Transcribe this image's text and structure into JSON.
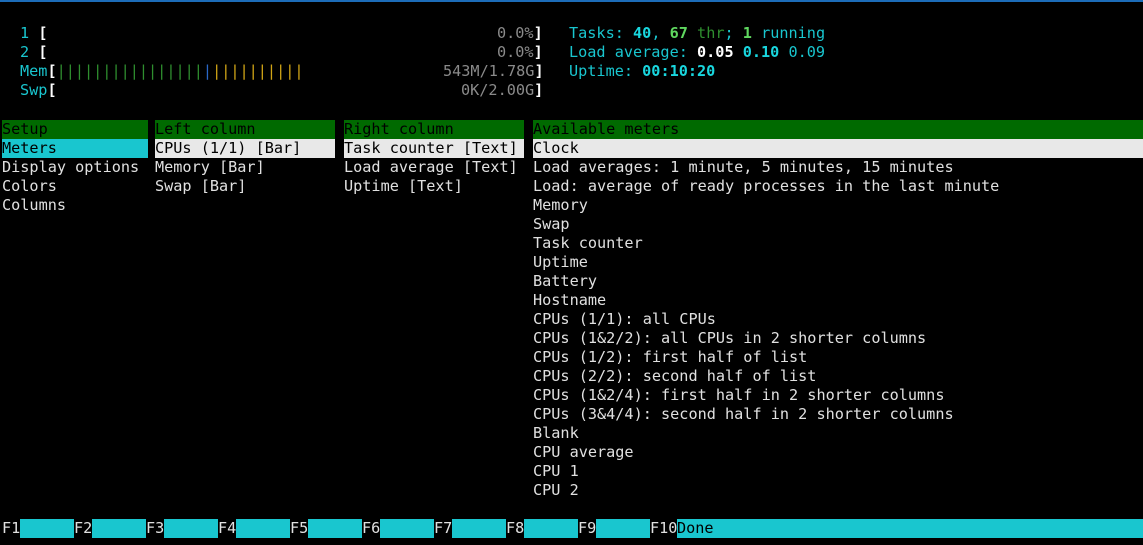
{
  "meters": {
    "cpu1": {
      "label": "1",
      "value": "0.0%"
    },
    "cpu2": {
      "label": "2",
      "value": "0.0%"
    },
    "mem": {
      "label": "Mem",
      "value": "543M/1.78G",
      "green_bars": "||||||||||||||||",
      "blue_bars": "|",
      "yellow_bars": "||||||||||"
    },
    "swp": {
      "label": "Swp",
      "value": "0K/2.00G"
    },
    "open_bracket": "[",
    "close_bracket": "]"
  },
  "stats": {
    "tasks_label": "Tasks: ",
    "tasks_count": "40",
    "sep1": ", ",
    "threads_count": "67",
    "threads_label": " thr",
    "sep2": "; ",
    "running_count": "1",
    "running_label": " running",
    "load_label": "Load average: ",
    "load1": "0.05",
    "load5": "0.10",
    "load15": "0.09",
    "uptime_label": "Uptime: ",
    "uptime_value": "00:10:20"
  },
  "panels": {
    "setup": {
      "header": "Setup",
      "items": [
        "Meters",
        "Display options",
        "Colors",
        "Columns"
      ]
    },
    "left_column": {
      "header": "Left column",
      "items": [
        "CPUs (1/1) [Bar]",
        "Memory [Bar]",
        "Swap [Bar]"
      ]
    },
    "right_column": {
      "header": "Right column",
      "items": [
        "Task counter [Text]",
        "Load average [Text]",
        "Uptime [Text]"
      ]
    },
    "available": {
      "header": "Available meters",
      "items": [
        "Clock",
        "Load averages: 1 minute, 5 minutes, 15 minutes",
        "Load: average of ready processes in the last minute",
        "Memory",
        "Swap",
        "Task counter",
        "Uptime",
        "Battery",
        "Hostname",
        "CPUs (1/1): all CPUs",
        "CPUs (1&2/2): all CPUs in 2 shorter columns",
        "CPUs (1/2): first half of list",
        "CPUs (2/2): second half of list",
        "CPUs (1&2/4): first half in 2 shorter columns",
        "CPUs (3&4/4): second half in 2 shorter columns",
        "Blank",
        "CPU average",
        "CPU 1",
        "CPU 2"
      ]
    }
  },
  "function_keys": [
    {
      "key": "F1",
      "label": ""
    },
    {
      "key": "F2",
      "label": ""
    },
    {
      "key": "F3",
      "label": ""
    },
    {
      "key": "F4",
      "label": ""
    },
    {
      "key": "F5",
      "label": ""
    },
    {
      "key": "F6",
      "label": ""
    },
    {
      "key": "F7",
      "label": ""
    },
    {
      "key": "F8",
      "label": ""
    },
    {
      "key": "F9",
      "label": ""
    },
    {
      "key": "F10",
      "label": "Done"
    }
  ],
  "colors": {
    "accent_cyan": "#19c6cf",
    "header_green": "#006a00",
    "selection_white": "#e8e8e8"
  }
}
